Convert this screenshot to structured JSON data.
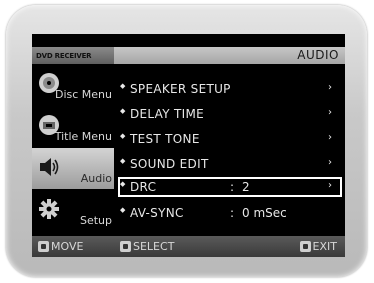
{
  "header": {
    "device": "DVD RECEIVER",
    "section": "AUDIO"
  },
  "sidebar": {
    "items": [
      {
        "label": "Disc Menu",
        "icon": "disc-icon"
      },
      {
        "label": "Title Menu",
        "icon": "title-icon"
      },
      {
        "label": "Audio",
        "icon": "speaker-icon",
        "active": true
      },
      {
        "label": "Setup",
        "icon": "gear-icon"
      }
    ]
  },
  "menu": {
    "items": [
      {
        "label": "SPEAKER SETUP",
        "value": "",
        "arrow": "›"
      },
      {
        "label": "DELAY TIME",
        "value": "",
        "arrow": "›"
      },
      {
        "label": "TEST TONE",
        "value": "",
        "arrow": "›"
      },
      {
        "label": "SOUND EDIT",
        "value": "",
        "arrow": "›"
      },
      {
        "label": "DRC",
        "colon": ":",
        "value": "2",
        "arrow": "›",
        "selected": true
      },
      {
        "label": "AV-SYNC",
        "colon": ":",
        "value": "0 mSec",
        "arrow": ""
      }
    ],
    "bullet": "◆"
  },
  "footer": {
    "move": "MOVE",
    "select": "SELECT",
    "exit": "EXIT"
  },
  "colors": {
    "screen_bg": "#000000",
    "bezel": "#c9c9c9",
    "header_bar": "#b0b0b0",
    "selection_border": "#ffffff",
    "text": "#e8e8e8"
  }
}
